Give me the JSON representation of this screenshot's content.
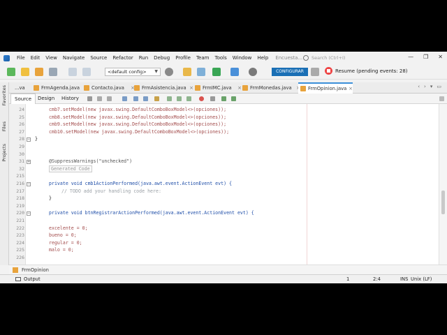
{
  "menubar": {
    "items": [
      "File",
      "Edit",
      "View",
      "Navigate",
      "Source",
      "Refactor",
      "Run",
      "Debug",
      "Profile",
      "Team",
      "Tools",
      "Window",
      "Help"
    ],
    "project_hint": "Encuesta...",
    "search_placeholder": "Search (Ctrl+I)",
    "window_controls": [
      "—",
      "❐",
      "✕"
    ]
  },
  "toolbar": {
    "config_value": "<default config>",
    "profiler_label": "CONFIGURAR",
    "resume_label": "Resume (pending events: 28)"
  },
  "left_strip": {
    "tabs": [
      "Favorites",
      "Files",
      "Projects"
    ]
  },
  "tabs": {
    "items": [
      {
        "label": "...va",
        "active": false
      },
      {
        "label": "FrmAgenda.java",
        "active": false
      },
      {
        "label": "Contacto.java",
        "active": false
      },
      {
        "label": "FrmAsistencia.java",
        "active": false
      },
      {
        "label": "FrmIMC.java",
        "active": false
      },
      {
        "label": "FrmMonedas.java",
        "active": false
      },
      {
        "label": "FrmOpinion.java",
        "active": true
      }
    ],
    "nav": [
      "‹",
      "›",
      "▾",
      "▭"
    ]
  },
  "viewbar": {
    "tabs": [
      "Source",
      "Design",
      "History"
    ],
    "active": "Source"
  },
  "editor": {
    "line_numbers": [
      "24",
      "25",
      "26",
      "27",
      "28",
      "29",
      "30",
      "31",
      "32",
      "215",
      "216",
      "217",
      "218",
      "219",
      "220",
      "221",
      "222",
      "223",
      "224",
      "225",
      "226"
    ],
    "lines": [
      {
        "text": "cmb7.setModel(new javax.swing.DefaultComboBoxModel<>(opciones));"
      },
      {
        "text": "cmb8.setModel(new javax.swing.DefaultComboBoxModel<>(opciones));"
      },
      {
        "text": "cmb9.setModel(new javax.swing.DefaultComboBoxModel<>(opciones));"
      },
      {
        "text": "cmb10.setModel(new javax.swing.DefaultComboBoxModel<>(opciones));"
      },
      {
        "text": "}"
      },
      {
        "text": ""
      },
      {
        "text": ""
      },
      {
        "text": "@SuppressWarnings(\"unchecked\")"
      },
      {
        "text": "Generated Code"
      },
      {
        "text": ""
      },
      {
        "text": "private void cmb1ActionPerformed(java.awt.event.ActionEvent evt) {"
      },
      {
        "text": "// TODO add your handling code here:"
      },
      {
        "text": "}"
      },
      {
        "text": ""
      },
      {
        "text": "private void btnRegistrarActionPerformed(java.awt.event.ActionEvent evt) {"
      },
      {
        "text": ""
      },
      {
        "text": "excelente = 0;"
      },
      {
        "text": "bueno = 0;"
      },
      {
        "text": "regular = 0;"
      },
      {
        "text": "malo = 0;"
      },
      {
        "text": ""
      }
    ]
  },
  "navigator": {
    "label": "FrmOpinion"
  },
  "statusbar": {
    "output_label": "Output",
    "notification_count": "1",
    "cursor_position": "2:4",
    "insert_mode": "INS",
    "line_endings": "Unix (LF)"
  }
}
